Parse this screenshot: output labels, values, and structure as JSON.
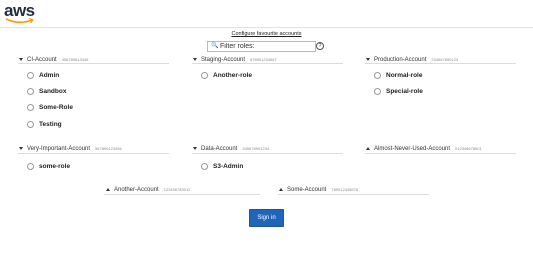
{
  "header": {
    "logo_text": "aws"
  },
  "configure_link": "Configure favourite accounts",
  "filter": {
    "placeholder": "Filter roles:",
    "search_icon": "search-icon",
    "help_icon": "help-icon"
  },
  "accounts": {
    "ci": {
      "name": "CI-Account",
      "number": "456789813345",
      "roles": [
        "Admin",
        "Sandbox",
        "Some-Role",
        "Testing"
      ]
    },
    "staging": {
      "name": "Staging-Account",
      "number": "678901234567",
      "roles": [
        "Another-role"
      ]
    },
    "production": {
      "name": "Production-Account",
      "number": "234567890123",
      "roles": [
        "Normal-role",
        "Special-role"
      ]
    },
    "very_important": {
      "name": "Very-Important-Account",
      "number": "567890123456",
      "roles": [
        "some-role"
      ]
    },
    "data": {
      "name": "Data-Account",
      "number": "345678901234",
      "roles": [
        "S3-Admin"
      ]
    },
    "almost_never": {
      "name": "Almost-Never-Used-Account",
      "number": "012345678901"
    },
    "another": {
      "name": "Another-Account",
      "number": "123456789012"
    },
    "some": {
      "name": "Some-Account",
      "number": "789012345678"
    }
  },
  "sign_in_label": "Sign in",
  "colors": {
    "button": "#1f66b8",
    "logo": "#232f3e",
    "logo_smile": "#ff9900"
  }
}
